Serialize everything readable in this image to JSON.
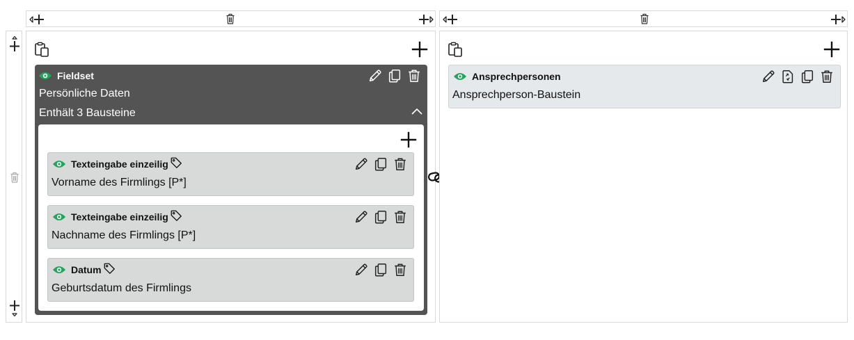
{
  "colors": {
    "eye_green": "#22a45d",
    "fieldset_bg": "#545454",
    "card_bg": "#d8dada",
    "rcard_bg": "#e6e9ec"
  },
  "icons": [
    "add-left-icon",
    "delete-icon",
    "add-right-icon",
    "move-up-icon",
    "move-down-icon",
    "add-icon",
    "paste-icon",
    "visible-eye-icon",
    "edit-pencil-icon",
    "copy-icon",
    "trash-icon",
    "tag-icon",
    "chevron-up-icon",
    "link-chain-icon",
    "reference-icon"
  ],
  "left_column": {
    "fieldset": {
      "type": "Fieldset",
      "description": "Persönliche Daten",
      "count_text": "Enthält 3 Bausteine",
      "children": [
        {
          "type": "Texteingabe einzeilig",
          "description": "Vorname des Firmlings [P*]"
        },
        {
          "type": "Texteingabe einzeilig",
          "description": "Nachname des Firmlings [P*]"
        },
        {
          "type": "Datum",
          "description": "Geburtsdatum des Firmlings"
        }
      ]
    }
  },
  "right_column": {
    "block": {
      "type": "Ansprechpersonen",
      "description": "Ansprechperson-Baustein"
    }
  }
}
